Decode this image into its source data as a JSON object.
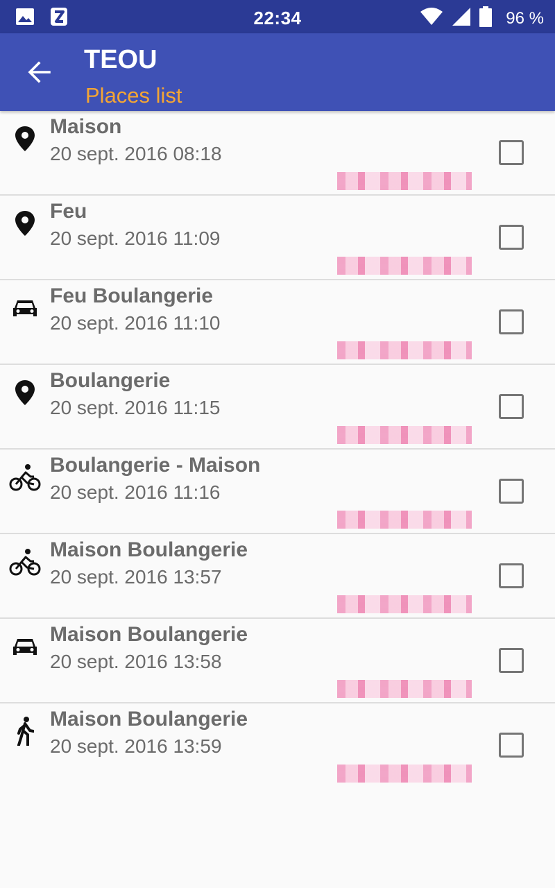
{
  "status_bar": {
    "time": "22:34",
    "battery": "96 %",
    "icons": [
      "image-icon",
      "app-notification-icon",
      "wifi-icon",
      "cell-signal-icon",
      "battery-icon"
    ]
  },
  "app_bar": {
    "title": "TEOU",
    "subtitle": "Places list",
    "back_icon": "arrow-back-icon",
    "colors": {
      "background": "#3f51b5",
      "status_bar": "#2b3a95",
      "subtitle": "#f4a534"
    }
  },
  "places": [
    {
      "icon": "place-marker-icon",
      "title": "Maison",
      "date": "20 sept. 2016 08:18",
      "checked": false
    },
    {
      "icon": "place-marker-icon",
      "title": "Feu",
      "date": "20 sept. 2016 11:09",
      "checked": false
    },
    {
      "icon": "car-icon",
      "title": "Feu Boulangerie",
      "date": "20 sept. 2016 11:10",
      "checked": false
    },
    {
      "icon": "place-marker-icon",
      "title": "Boulangerie",
      "date": "20 sept. 2016 11:15",
      "checked": false
    },
    {
      "icon": "bicycle-icon",
      "title": "Boulangerie - Maison",
      "date": "20 sept. 2016 11:16",
      "checked": false
    },
    {
      "icon": "bicycle-icon",
      "title": "Maison Boulangerie",
      "date": "20 sept. 2016 13:57",
      "checked": false
    },
    {
      "icon": "car-icon",
      "title": "Maison Boulangerie",
      "date": "20 sept. 2016 13:58",
      "checked": false
    },
    {
      "icon": "walking-icon",
      "title": "Maison Boulangerie",
      "date": "20 sept. 2016 13:59",
      "checked": false
    }
  ]
}
